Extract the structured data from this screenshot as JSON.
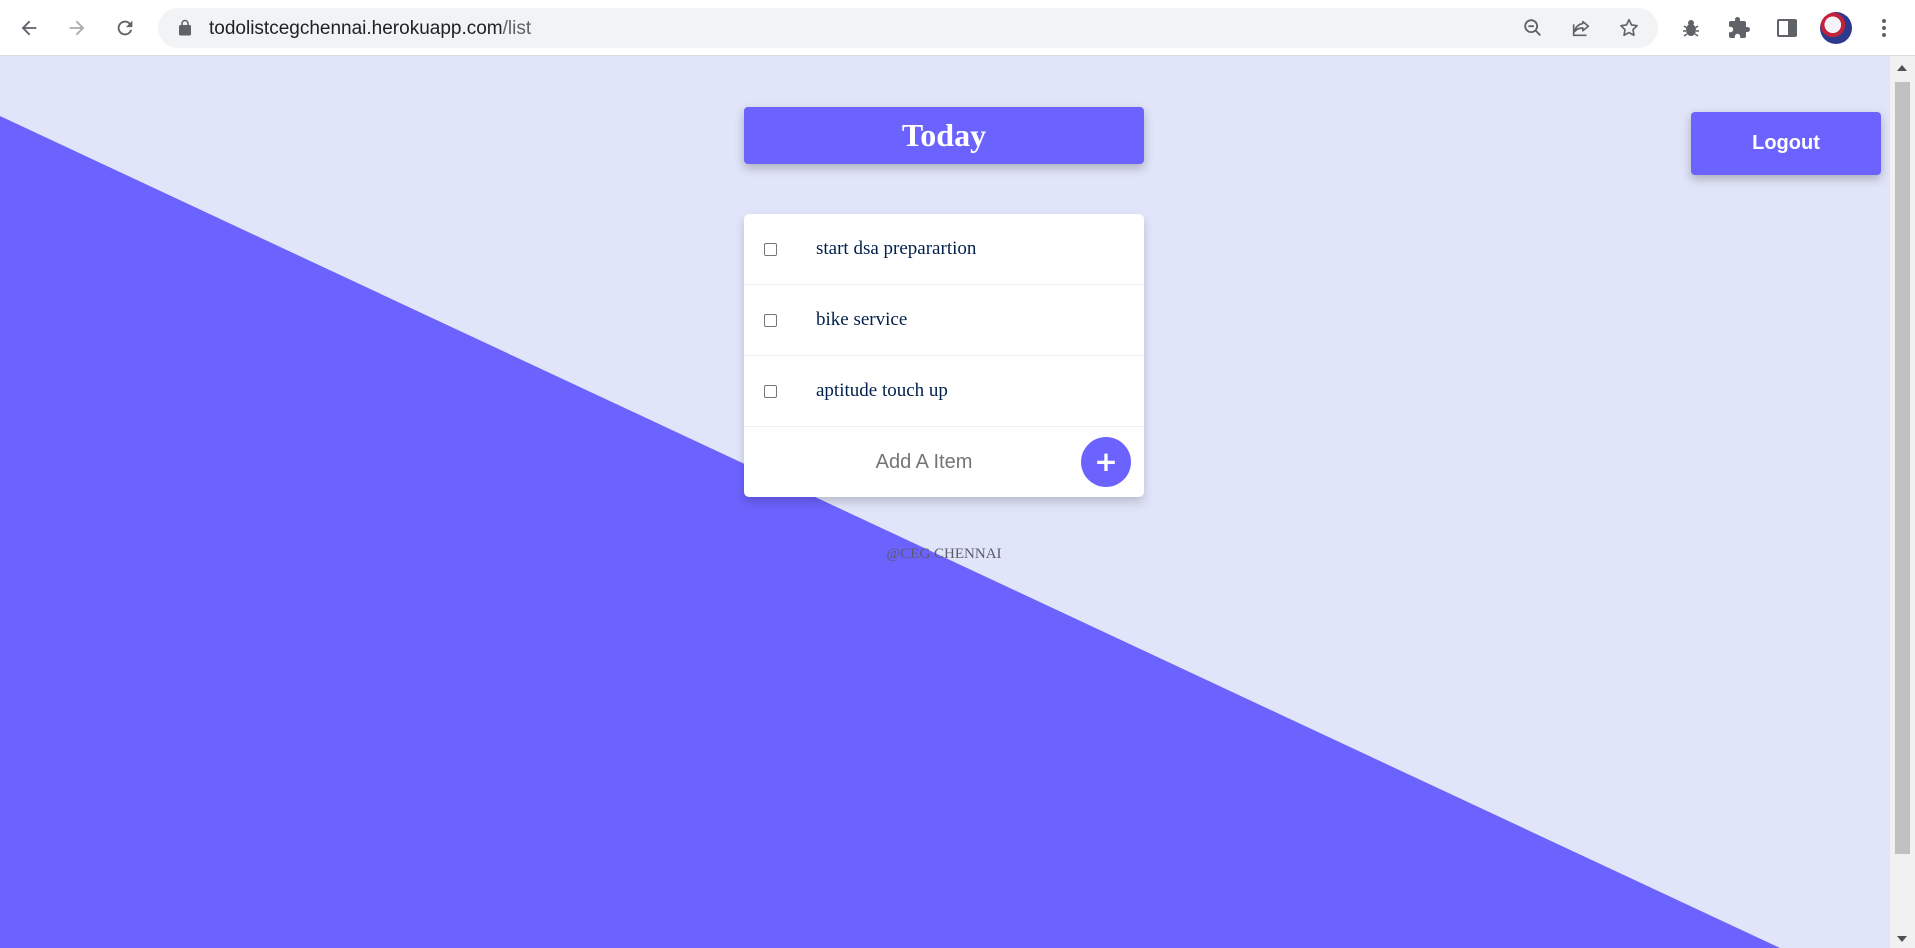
{
  "browser": {
    "url_host": "todolistcegchennai.herokuapp.com",
    "url_path": "/list",
    "icons": [
      "back-icon",
      "forward-icon",
      "reload-icon",
      "lock-icon",
      "zoom-out-icon",
      "share-icon",
      "star-icon",
      "bug-icon",
      "puzzle-icon",
      "side-panel-icon",
      "avatar",
      "more-icon"
    ]
  },
  "page": {
    "heading": "Today",
    "logout_label": "Logout",
    "items": [
      {
        "label": "start dsa preparartion",
        "checked": false
      },
      {
        "label": "bike service",
        "checked": false
      },
      {
        "label": "aptitude touch up",
        "checked": false
      }
    ],
    "add_placeholder": "Add A Item",
    "add_button_label": "+",
    "footer": "@CEG CHENNAI"
  },
  "colors": {
    "accent": "#6c63ff",
    "background": "#e1e5f9",
    "item_text": "#00204a"
  }
}
